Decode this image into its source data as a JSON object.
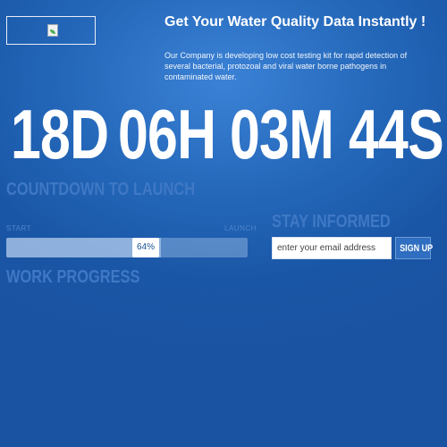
{
  "header": {
    "headline": "Get Your Water Quality Data Instantly !",
    "intro": "Our Company is developing low cost testing kit for rapid detection of several bacterial, protozoal and viral water borne pathogens in contaminated water."
  },
  "logo": {
    "icon": "broken-image-icon"
  },
  "countdown": {
    "days": "18D",
    "hours": "06H",
    "minutes": "03M",
    "seconds": "44S",
    "label": "COUNTDOWN TO LAUNCH"
  },
  "progress": {
    "start_label": "START",
    "end_label": "LAUNCH",
    "value_text": "64%",
    "percent": 64,
    "label": "WORK PROGRESS"
  },
  "subscribe": {
    "heading": "STAY INFORMED",
    "placeholder": "enter your email address",
    "button_label": "SIGN UP"
  },
  "colors": {
    "background": "#1a56a6",
    "faded_text": "#3f78c4",
    "button": "#2f6ec0"
  }
}
